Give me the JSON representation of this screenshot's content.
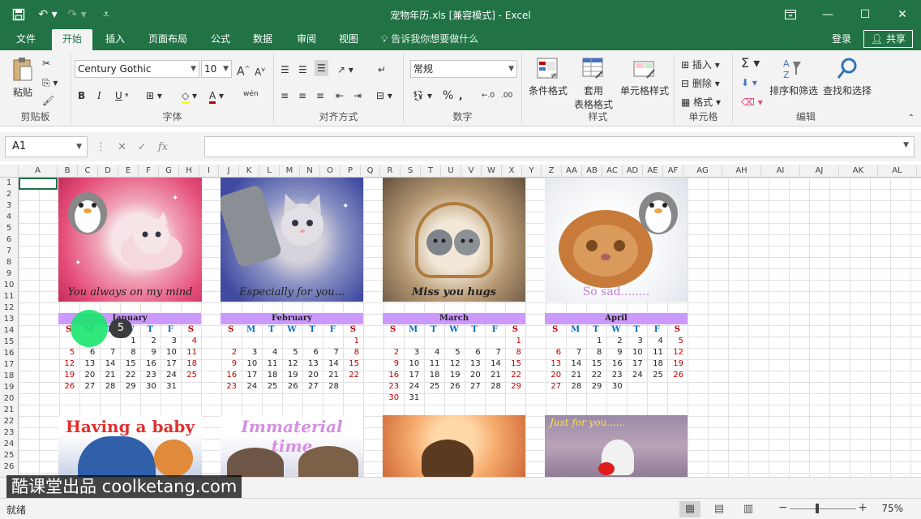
{
  "window": {
    "title": "宠物年历.xls  [兼容模式] - Excel",
    "qat": [
      "save-icon",
      "undo-icon",
      "redo-icon",
      "customize-icon"
    ],
    "controls": [
      "ribbon-display-icon",
      "minimize-icon",
      "maximize-icon",
      "close-icon"
    ]
  },
  "tabs": [
    "文件",
    "开始",
    "插入",
    "页面布局",
    "公式",
    "数据",
    "审阅",
    "视图"
  ],
  "active_tab": "开始",
  "tellme": "告诉我你想要做什么",
  "login": "登录",
  "share": "共享",
  "ribbon": {
    "clipboard": {
      "label": "剪贴板",
      "paste": "粘贴"
    },
    "font": {
      "label": "字体",
      "name": "Century Gothic",
      "size": "10",
      "bold": "B",
      "italic": "I",
      "underline": "U",
      "wen": "wén"
    },
    "align": {
      "label": "对齐方式"
    },
    "number": {
      "label": "数字",
      "format": "常规"
    },
    "styles": {
      "label": "样式",
      "cond": "条件格式",
      "table": "套用",
      "table2": "表格格式",
      "cell": "单元格样式"
    },
    "cells": {
      "label": "单元格",
      "insert": "插入",
      "delete": "删除",
      "format": "格式"
    },
    "editing": {
      "label": "编辑",
      "sort": "排序和筛选",
      "find": "查找和选择"
    }
  },
  "namebox": "A1",
  "formula_value": "",
  "columns": [
    "A",
    "B",
    "C",
    "D",
    "E",
    "F",
    "G",
    "H",
    "I",
    "J",
    "K",
    "L",
    "M",
    "N",
    "O",
    "P",
    "Q",
    "R",
    "S",
    "T",
    "U",
    "V",
    "W",
    "X",
    "Y",
    "Z",
    "AA",
    "AB",
    "AC",
    "AD",
    "AE",
    "AF",
    "AG",
    "AH",
    "AI",
    "AJ",
    "AK",
    "AL"
  ],
  "rows": [
    "1",
    "2",
    "3",
    "4",
    "5",
    "6",
    "7",
    "8",
    "9",
    "10",
    "11",
    "12",
    "13",
    "14",
    "15",
    "16",
    "17",
    "18",
    "19",
    "20",
    "21",
    "22",
    "23",
    "24",
    "25",
    "26"
  ],
  "pictures": [
    {
      "caption": "You always on my mind"
    },
    {
      "caption": "Especially for you..."
    },
    {
      "caption": "Miss you hugs"
    },
    {
      "caption": "So sad........"
    },
    {
      "caption": "Having a baby"
    },
    {
      "caption": "Immaterial time"
    },
    {
      "caption": ""
    },
    {
      "caption": "Just for you......"
    }
  ],
  "weekday_headers": [
    "S",
    "M",
    "T",
    "W",
    "T",
    "F",
    "S"
  ],
  "calendars": [
    {
      "month": "January",
      "weeks": [
        [
          "",
          "",
          "",
          "1",
          "2",
          "3",
          "4"
        ],
        [
          "5",
          "6",
          "7",
          "8",
          "9",
          "10",
          "11"
        ],
        [
          "12",
          "13",
          "14",
          "15",
          "16",
          "17",
          "18"
        ],
        [
          "19",
          "20",
          "21",
          "22",
          "23",
          "24",
          "25"
        ],
        [
          "26",
          "27",
          "28",
          "29",
          "30",
          "31",
          ""
        ],
        [
          "",
          "",
          "",
          "",
          "",
          "",
          ""
        ]
      ]
    },
    {
      "month": "February",
      "weeks": [
        [
          "",
          "",
          "",
          "",
          "",
          "",
          "1"
        ],
        [
          "2",
          "3",
          "4",
          "5",
          "6",
          "7",
          "8"
        ],
        [
          "9",
          "10",
          "11",
          "12",
          "13",
          "14",
          "15"
        ],
        [
          "16",
          "17",
          "18",
          "19",
          "20",
          "21",
          "22"
        ],
        [
          "23",
          "24",
          "25",
          "26",
          "27",
          "28",
          ""
        ],
        [
          "",
          "",
          "",
          "",
          "",
          "",
          ""
        ]
      ]
    },
    {
      "month": "March",
      "weeks": [
        [
          "",
          "",
          "",
          "",
          "",
          "",
          "1"
        ],
        [
          "2",
          "3",
          "4",
          "5",
          "6",
          "7",
          "8"
        ],
        [
          "9",
          "10",
          "11",
          "12",
          "13",
          "14",
          "15"
        ],
        [
          "16",
          "17",
          "18",
          "19",
          "20",
          "21",
          "22"
        ],
        [
          "23",
          "24",
          "25",
          "26",
          "27",
          "28",
          "29"
        ],
        [
          "30",
          "31",
          "",
          "",
          "",
          "",
          ""
        ]
      ]
    },
    {
      "month": "April",
      "weeks": [
        [
          "",
          "",
          "1",
          "2",
          "3",
          "4",
          "5"
        ],
        [
          "6",
          "7",
          "8",
          "9",
          "10",
          "11",
          "12"
        ],
        [
          "13",
          "14",
          "15",
          "16",
          "17",
          "18",
          "19"
        ],
        [
          "20",
          "21",
          "22",
          "23",
          "24",
          "25",
          "26"
        ],
        [
          "27",
          "28",
          "29",
          "30",
          "",
          "",
          ""
        ],
        [
          "",
          "",
          "",
          "",
          "",
          "",
          ""
        ]
      ]
    }
  ],
  "click_step": "5",
  "watermark": "酷课堂出品 coolketang.com",
  "status": {
    "ready": "就绪",
    "zoom": "75%"
  },
  "colors": {
    "accent": "#217346",
    "month_band": "#cc99ff",
    "weekend": "#c00000",
    "weekday": "#0070c0"
  }
}
